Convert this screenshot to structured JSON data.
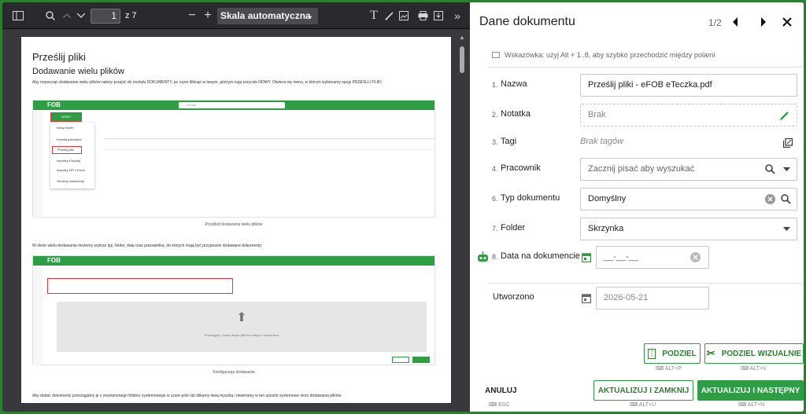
{
  "viewer": {
    "page_number": "1",
    "page_total": "z 7",
    "zoom": "Skala automatyczna"
  },
  "pdf": {
    "h1": "Prześlij pliki",
    "h2": "Dodawanie wielu plików",
    "p1": "Aby rozpocząć dodawanie wielu plików należy przejść do modułu DOKUMENTY, po czym kliknąć w lewym, górnym rogu przycisk NOWY. Otwiera się menu, w którym wybieramy opcję PRZEŚLIJ PLIKI:",
    "logo": "FOB",
    "search": "Szukaj",
    "new_btn": "NOWY",
    "menu": [
      "Nowy folder",
      "Prześlij dokument",
      "Prześlij pliki",
      "Importuj eTeczkę",
      "Importuj ZIP z Excel",
      "Generuj dokumenty"
    ],
    "caption1": "Przykład dodawania wielu plików",
    "p2": "W oknie wielo-dodawania możemy wybrać typ, folder, datę oraz pracownika, do których mają być przypisane dodawane dokumenty:",
    "drop_text": "Przeciągnij i upuść swoje pliki lub załącz z komputera",
    "caption2": "Konfiguracja dodawania",
    "p3": "Aby dodać dokumenty przeciągamy je z zewnętrznego folderu systemowego w szare pole lub klikamy lewą myszką i otwieramy w ten sposób systemowe okno dodawania plików:"
  },
  "panel": {
    "title": "Dane dokumentu",
    "pager": "1/2",
    "hint": "Wskazówka: użyj Alt + 1..8, aby szybko przechodzić między polami",
    "fields": [
      {
        "num": "1.",
        "label": "Nazwa",
        "value": "Prześlij pliki  - eFOB eTeczka.pdf"
      },
      {
        "num": "2.",
        "label": "Notatka",
        "value": "Brak"
      },
      {
        "num": "3.",
        "label": "Tagi",
        "value": "Brak tagów"
      },
      {
        "num": "4.",
        "label": "Pracownik",
        "value": "Zacznij pisać aby wyszukać"
      },
      {
        "num": "6.",
        "label": "Typ dokumentu",
        "value": "Domyślny"
      },
      {
        "num": "7.",
        "label": "Folder",
        "value": "Skrzynka"
      },
      {
        "num": "8.",
        "label": "Data na dokumencie",
        "value": "__-__-__"
      }
    ],
    "created_label": "Utworzono",
    "created_value": "2026-05-21",
    "split_btn": "PODZIEL",
    "split_kbd": "ALT+P",
    "split_visual_btn": "PODZIEL WIZUALNIE",
    "split_visual_kbd": "ALT+V",
    "cancel": "ANULUJ",
    "cancel_kbd": "ESC",
    "update_close": "AKTUALIZUJ I ZAMKNIJ",
    "update_close_kbd": "ALT+U",
    "update_next": "AKTUALIZUJ I NASTĘPNY",
    "update_next_kbd": "ALT+N"
  },
  "colors": {
    "accent": "#2e9e44",
    "frame": "#2e7d32",
    "viewer_bg": "#38383d"
  }
}
